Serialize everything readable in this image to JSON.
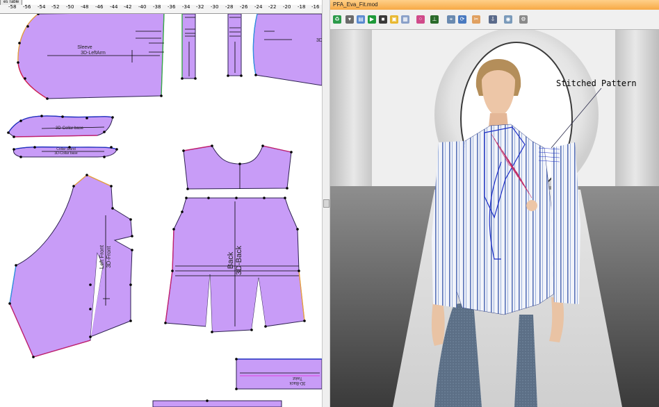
{
  "left_pane": {
    "tab_label": "es Table",
    "ruler_labels": [
      "-58",
      "-56",
      "-54",
      "-52",
      "-50",
      "-48",
      "-46",
      "-44",
      "-42",
      "-40",
      "-38",
      "-36",
      "-34",
      "-32",
      "-30",
      "-28",
      "-26",
      "-24",
      "-22",
      "-20",
      "-18",
      "-16"
    ],
    "pieces": {
      "sleeve": "Sleeve",
      "sleeve_3d": "3D-LeftArm",
      "collar_3d": "3D-Collar base",
      "collar_stand": "Collar Stand",
      "collar_stand_3d": "3D-Collar base",
      "left_front": "Left Front",
      "left_front_3d": "3D-Front",
      "back": "Back",
      "back_3d": "3D-Back",
      "twist": "Twist",
      "twist_3d": "3D-Back",
      "cut_3d": "3D"
    }
  },
  "right_pane": {
    "window_title": "PFA_Eva_Fit.mod",
    "callout": "Stitched Pattern"
  },
  "colors": {
    "pattern_fill": "#c89cf7",
    "title_bar": "#f7a945",
    "toolbar": "#f0f0f0"
  }
}
